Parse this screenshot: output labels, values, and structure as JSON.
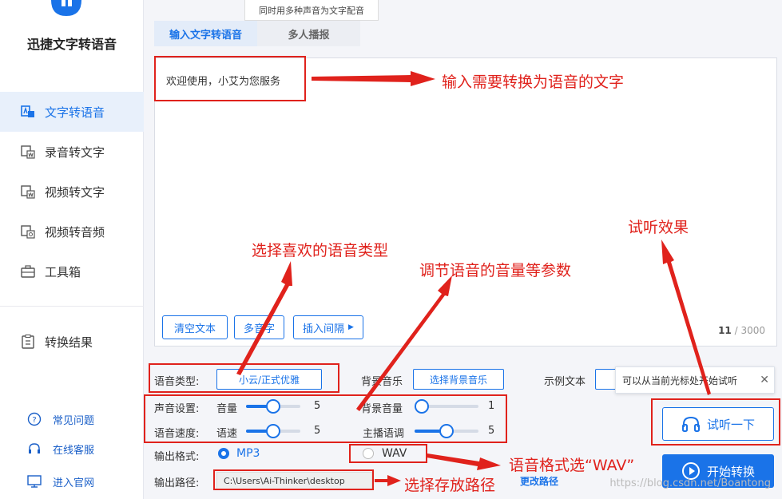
{
  "app": {
    "title": "迅捷文字转语音"
  },
  "sidebar": {
    "items": [
      {
        "label": "文字转语音",
        "icon": "text-to-speech-icon"
      },
      {
        "label": "录音转文字",
        "icon": "record-to-text-icon"
      },
      {
        "label": "视频转文字",
        "icon": "video-to-text-icon"
      },
      {
        "label": "视频转音频",
        "icon": "video-to-audio-icon"
      },
      {
        "label": "工具箱",
        "icon": "toolbox-icon"
      },
      {
        "label": "转换结果",
        "icon": "result-icon"
      }
    ],
    "bottom": [
      {
        "label": "常见问题",
        "icon": "faq-icon"
      },
      {
        "label": "在线客服",
        "icon": "headset-icon"
      },
      {
        "label": "进入官网",
        "icon": "monitor-icon"
      }
    ]
  },
  "tooltip_top": "同时用多种声音为文字配音",
  "tabs": [
    {
      "label": "输入文字转语音"
    },
    {
      "label": "多人播报"
    }
  ],
  "editor": {
    "text": "欢迎使用，小艾为您服务",
    "clear_label": "清空文本",
    "polyphone_label": "多音字",
    "insert_pause_label": "插入间隔",
    "char_count": "11",
    "char_max": "/ 3000"
  },
  "settings": {
    "voice_type_label": "语音类型:",
    "voice_type_value": "小云/正式优雅",
    "bg_music_label": "背景音乐",
    "bg_music_button": "选择背景音乐",
    "sample_text_label": "示例文本",
    "sound_label": "声音设置:",
    "volume_label": "音量",
    "volume_value": "5",
    "volume_level": 0.5,
    "bg_volume_label": "背景音量",
    "bg_volume_value": "1",
    "bg_volume_level": 0.0,
    "speed_label": "语音速度:",
    "speed_sub_label": "语速",
    "speed_value": "5",
    "speed_level": 0.5,
    "pitch_label": "主播语调",
    "pitch_value": "5",
    "pitch_level": 0.5,
    "format_label": "输出格式:",
    "format_mp3": "MP3",
    "format_wav": "WAV",
    "path_label": "输出路径:",
    "path_value": "C:\\Users\\Ai-Thinker\\desktop",
    "change_path": "更改路径"
  },
  "tip": {
    "text": "可以从当前光标处开始试听",
    "close": "✕"
  },
  "buttons": {
    "listen": "试听一下",
    "convert": "开始转换"
  },
  "annotations": {
    "input_text": "输入需要转换为语音的文字",
    "voice_type": "选择喜欢的语音类型",
    "params": "调节语音的音量等参数",
    "listen": "试听效果",
    "format": "语音格式选“WAV”",
    "path": "选择存放路径"
  },
  "watermark": "https://blog.csdn.net/Boantong",
  "colors": {
    "accent": "#1a73e8",
    "annotation": "#e0221c"
  }
}
